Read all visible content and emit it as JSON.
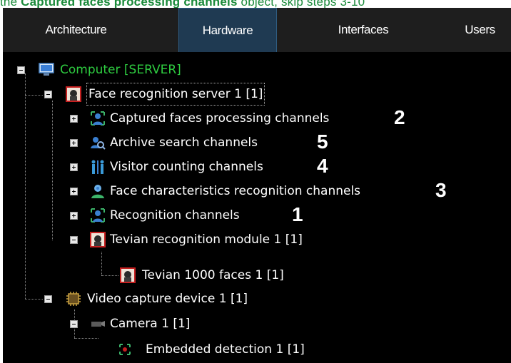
{
  "caption": {
    "prefix": "the ",
    "bold": "Captured faces processing channels",
    "suffix": " object, skip steps 3-10"
  },
  "tabs": [
    {
      "label": "Architecture",
      "active": false
    },
    {
      "label": "Hardware",
      "active": true
    },
    {
      "label": "Interfaces",
      "active": false
    },
    {
      "label": "Users",
      "active": false
    }
  ],
  "tree": {
    "computer": "Computer [SERVER]",
    "face_server": "Face recognition server 1 [1]",
    "captured": "Captured faces processing channels",
    "captured_num": "2",
    "archive": "Archive search channels",
    "archive_num": "5",
    "visitor": "Visitor counting channels",
    "visitor_num": "4",
    "characteristics": "Face characteristics recognition channels",
    "characteristics_num": "3",
    "recognition": "Recognition channels",
    "recognition_num": "1",
    "tevian_module": "Tevian recognition module 1 [1]",
    "tevian_faces": "Tevian 1000 faces 1 [1]",
    "video_capture": "Video capture device 1 [1]",
    "camera": "Camera 1 [1]",
    "embedded": "Embedded detection 1 [1]"
  },
  "colors": {
    "computer_label": "#2ecc40",
    "tab_active_bg": "#1f3a52",
    "caption_green": "#1a8a3a"
  }
}
